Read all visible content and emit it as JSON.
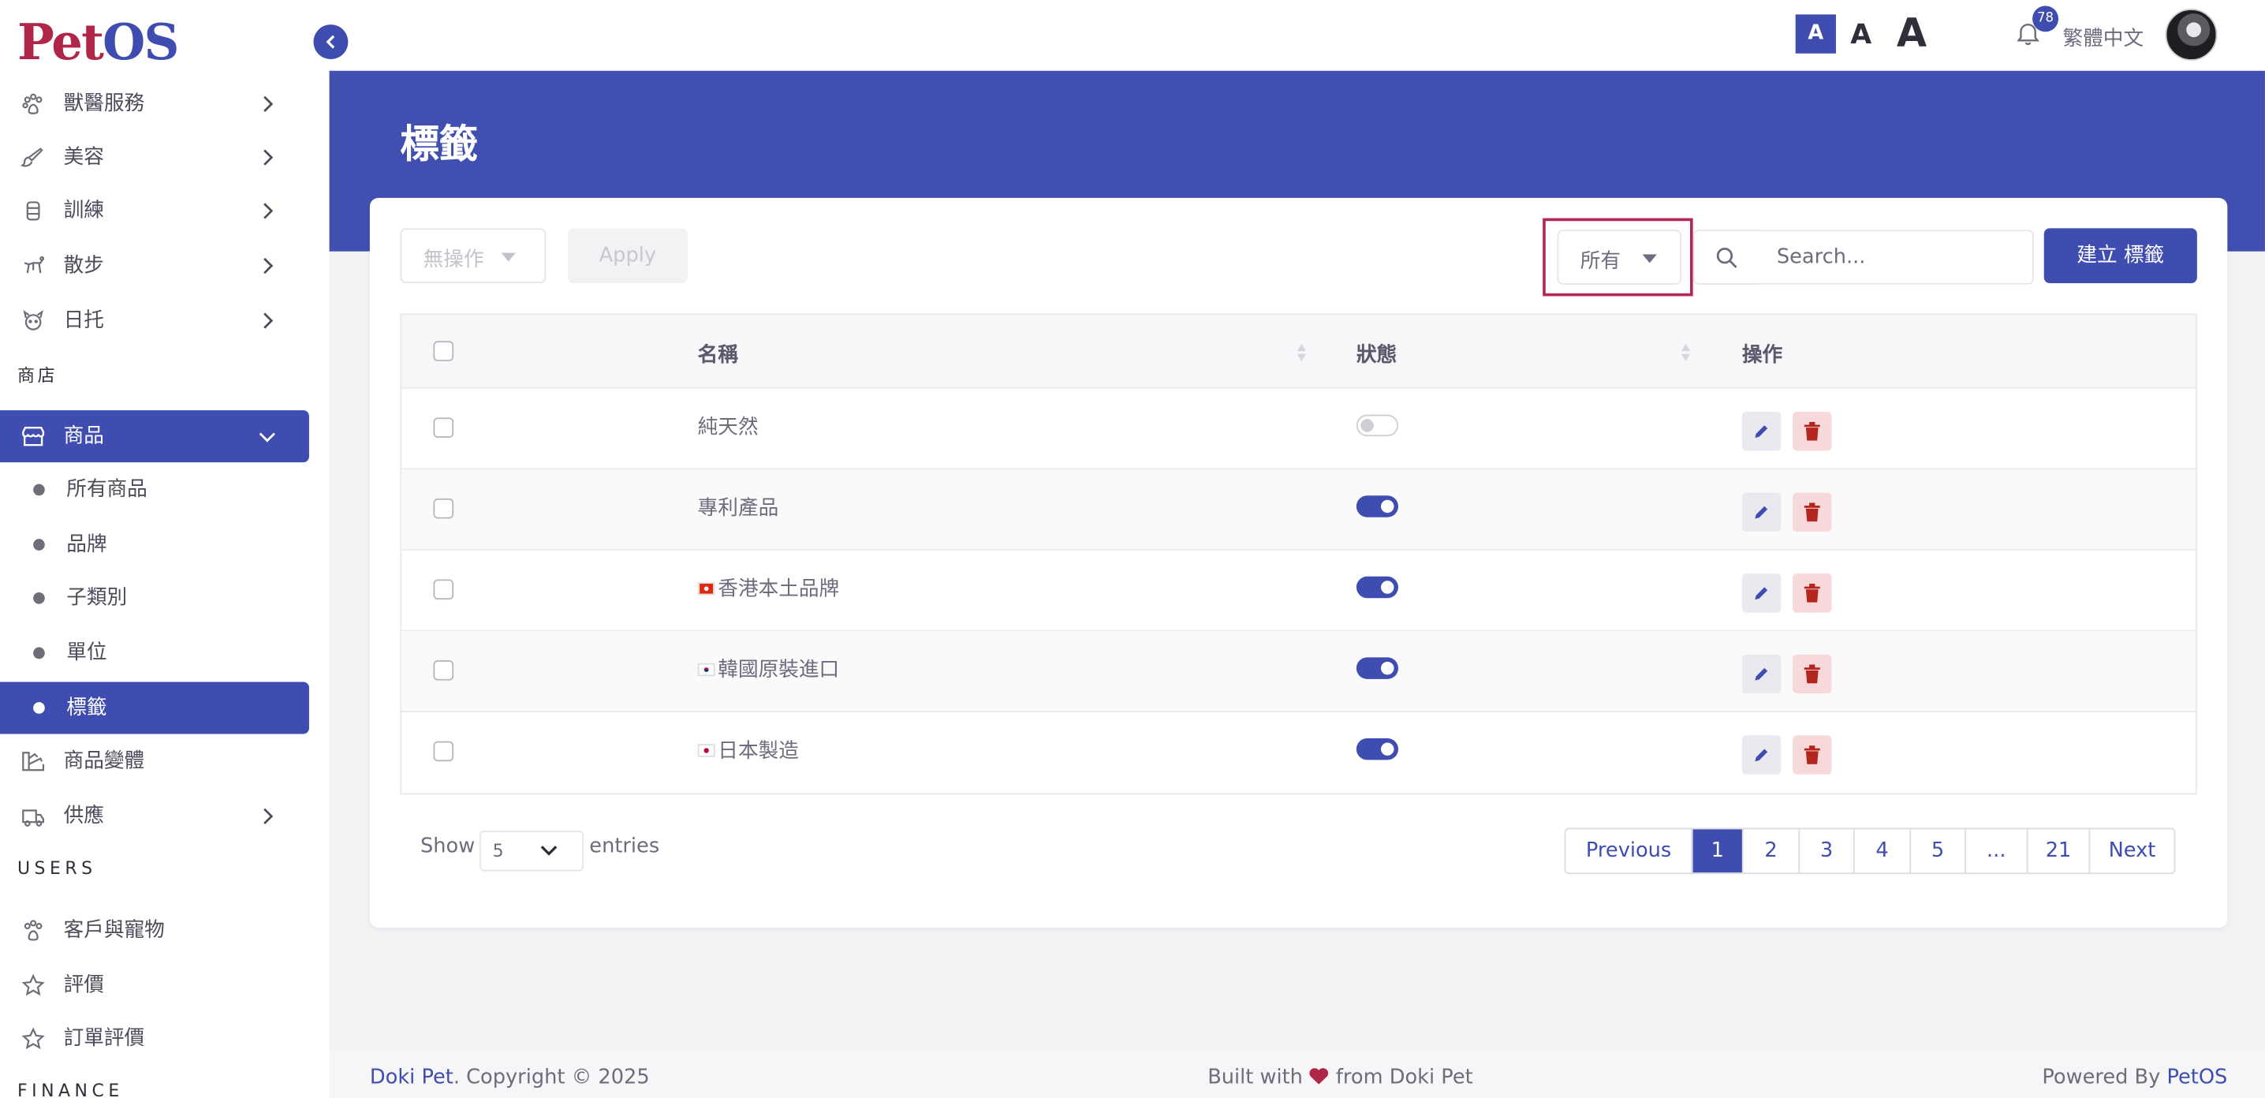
{
  "brand": {
    "logo_part1": "Pet",
    "logo_part2": "OS"
  },
  "sidebar": {
    "items_top": [
      {
        "label": "獸醫服務",
        "icon": "paw-icon"
      },
      {
        "label": "美容",
        "icon": "brush-icon"
      },
      {
        "label": "訓練",
        "icon": "bone-icon"
      },
      {
        "label": "散步",
        "icon": "dog-walk-icon"
      },
      {
        "label": "日托",
        "icon": "daycare-icon"
      }
    ],
    "section_shop": "商店",
    "products": {
      "label": "商品"
    },
    "product_sub": [
      {
        "label": "所有商品"
      },
      {
        "label": "品牌"
      },
      {
        "label": "子類別"
      },
      {
        "label": "單位"
      },
      {
        "label": "標籤"
      }
    ],
    "variants": {
      "label": "商品變體"
    },
    "supply": {
      "label": "供應"
    },
    "section_users": "USERS",
    "customers": {
      "label": "客戶與寵物"
    },
    "reviews": {
      "label": "評價"
    },
    "order_reviews": {
      "label": "訂單評價"
    },
    "section_finance": "FINANCE"
  },
  "header": {
    "font_small": "A",
    "font_medium": "A",
    "font_large": "A",
    "notification_count": "78",
    "language": "繁體中文"
  },
  "page": {
    "title": "標籤"
  },
  "toolbar": {
    "bulk_action": "無操作",
    "apply": "Apply",
    "filter": "所有",
    "search_placeholder": "Search...",
    "create": "建立 標籤"
  },
  "table": {
    "headers": {
      "name": "名稱",
      "status": "狀態",
      "actions": "操作"
    },
    "rows": [
      {
        "name": "純天然",
        "flag": "",
        "active": false
      },
      {
        "name": "專利產品",
        "flag": "",
        "active": true
      },
      {
        "name": "香港本土品牌",
        "flag": "hk",
        "active": true
      },
      {
        "name": "韓國原裝進口",
        "flag": "kr",
        "active": true
      },
      {
        "name": "日本製造",
        "flag": "jp",
        "active": true
      }
    ]
  },
  "pagination": {
    "show": "Show",
    "length": "5",
    "entries": "entries",
    "previous": "Previous",
    "next": "Next",
    "pages": [
      "1",
      "2",
      "3",
      "4",
      "5",
      "...",
      "21"
    ],
    "current": "1"
  },
  "footer": {
    "brand": "Doki Pet",
    "copyright": ". Copyright © 2025",
    "built_pre": "Built with",
    "built_post": "from Doki Pet",
    "powered_pre": "Powered By",
    "powered_brand": "PetOS"
  },
  "colors": {
    "primary": "#3f4db0",
    "brand_red": "#b02648",
    "highlight": "#b4275a",
    "danger": "#b3261e"
  }
}
